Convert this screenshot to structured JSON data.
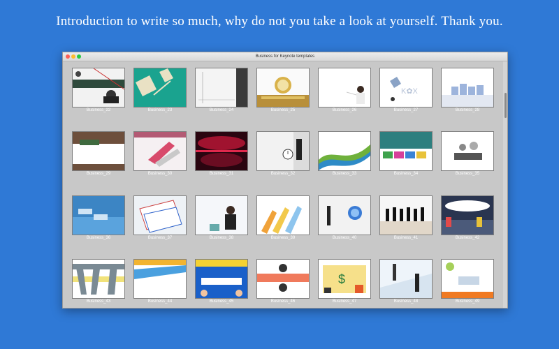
{
  "headline": "Introduction to write so much, why do not you take a look at yourself. Thank you.",
  "window": {
    "title": "Business for Keynote templates"
  },
  "items": [
    {
      "label": "Business_22"
    },
    {
      "label": "Business_23"
    },
    {
      "label": "Business_24"
    },
    {
      "label": "Business_25"
    },
    {
      "label": "Business_26"
    },
    {
      "label": "Business_27"
    },
    {
      "label": "Business_28"
    },
    {
      "label": "Business_29"
    },
    {
      "label": "Business_30"
    },
    {
      "label": "Business_31"
    },
    {
      "label": "Business_32"
    },
    {
      "label": "Business_33"
    },
    {
      "label": "Business_34"
    },
    {
      "label": "Business_35"
    },
    {
      "label": "Business_36"
    },
    {
      "label": "Business_37"
    },
    {
      "label": "Business_38"
    },
    {
      "label": "Business_39"
    },
    {
      "label": "Business_40"
    },
    {
      "label": "Business_41"
    },
    {
      "label": "Business_42"
    },
    {
      "label": "Business_43"
    },
    {
      "label": "Business_44"
    },
    {
      "label": "Business_45"
    },
    {
      "label": "Business_46"
    },
    {
      "label": "Business_47"
    },
    {
      "label": "Business_48"
    },
    {
      "label": "Business_49"
    }
  ],
  "colors": {
    "background": "#2f79d6",
    "window": "#c8c8c8",
    "close": "#fc5f57",
    "minimize": "#fdbc2e",
    "zoom": "#28c840"
  }
}
